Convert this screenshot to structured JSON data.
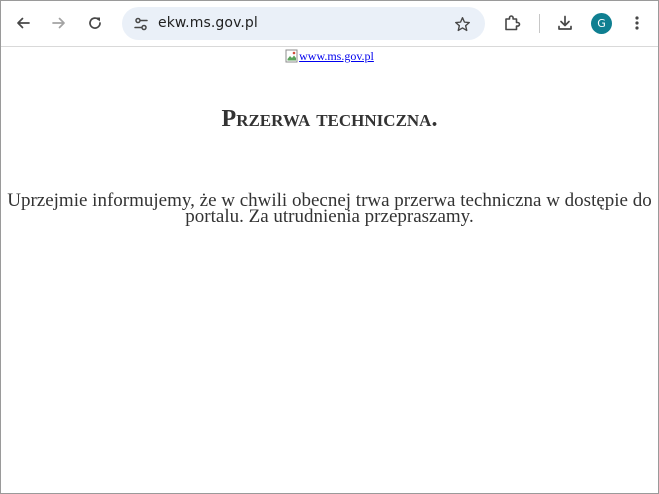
{
  "browser": {
    "url": "ekw.ms.gov.pl",
    "profile_initial": "G",
    "colors": {
      "omnibox_bg": "#eaf0f8",
      "avatar_bg": "#0f7f91",
      "link": "#0000ee",
      "text": "#333333"
    },
    "icons": {
      "back": "arrow-left-icon",
      "forward": "arrow-right-icon",
      "reload": "reload-icon",
      "site_info": "tune-icon",
      "bookmark": "star-icon",
      "extensions": "puzzle-icon",
      "downloads": "download-icon",
      "menu": "kebab-menu-icon"
    }
  },
  "page": {
    "logo_alt": "www.ms.gov.pl",
    "title": "Przerwa techniczna.",
    "message": "Uprzejmie informujemy, że w chwili obecnej trwa przerwa techniczna w dostępie do portalu. Za utrudnienia przepraszamy."
  }
}
